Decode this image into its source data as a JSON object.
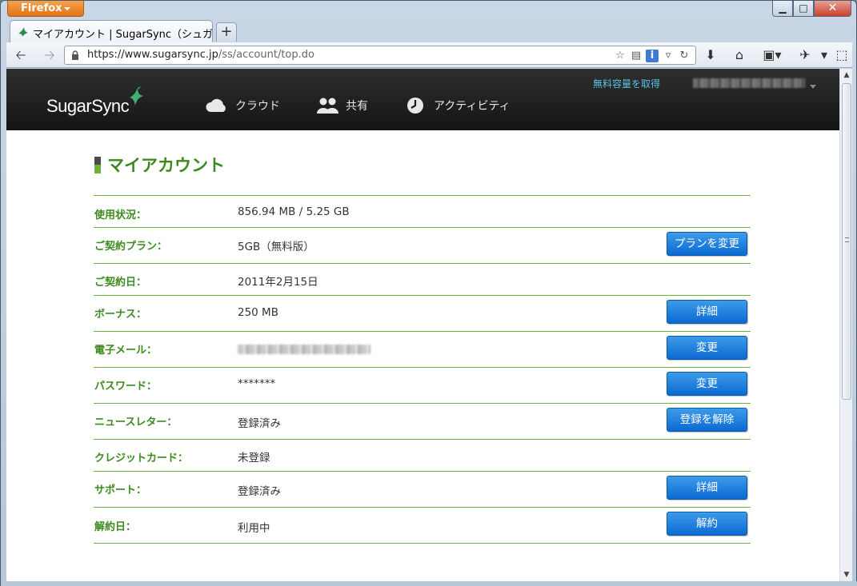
{
  "browser": {
    "menu_button_label": "Firefox",
    "tab_title": "マイアカウント | SugarSync（シュガ...",
    "new_tab_label": "+",
    "url_host": "https://www.sugarsync.jp",
    "url_path": "/ss/account/top.do"
  },
  "site": {
    "logo_text": "SugarSync",
    "nav": [
      {
        "label": "クラウド",
        "icon": "cloud-icon"
      },
      {
        "label": "共有",
        "icon": "people-icon"
      },
      {
        "label": "アクティビティ",
        "icon": "clock-icon"
      }
    ],
    "free_space_link": "無料容量を取得"
  },
  "page": {
    "title": "マイアカウント"
  },
  "account_rows": [
    {
      "label": "使用状況：",
      "value": "856.94 MB / 5.25 GB",
      "button": ""
    },
    {
      "label": "ご契約プラン：",
      "value": "5GB（無料版）",
      "button": "プランを変更"
    },
    {
      "label": "ご契約日：",
      "value": "2011年2月15日",
      "button": ""
    },
    {
      "label": "ボーナス：",
      "value": "250 MB",
      "button": "詳細"
    },
    {
      "label": "電子メール：",
      "value": "",
      "button": "変更"
    },
    {
      "label": "パスワード：",
      "value": "*******",
      "button": "変更"
    },
    {
      "label": "ニュースレター：",
      "value": "登録済み",
      "button": "登録を解除"
    },
    {
      "label": "クレジットカード：",
      "value": "未登録",
      "button": ""
    },
    {
      "label": "サポート：",
      "value": "登録済み",
      "button": "詳細"
    },
    {
      "label": "解約日：",
      "value": "利用中",
      "button": "解約"
    }
  ],
  "colors": {
    "accent_green": "#3c8a1d",
    "rule_green": "#6cb33e",
    "button_blue": "#0b6ad2",
    "header_dark": "#1f1f1f",
    "link_cyan": "#5bc2e7"
  }
}
